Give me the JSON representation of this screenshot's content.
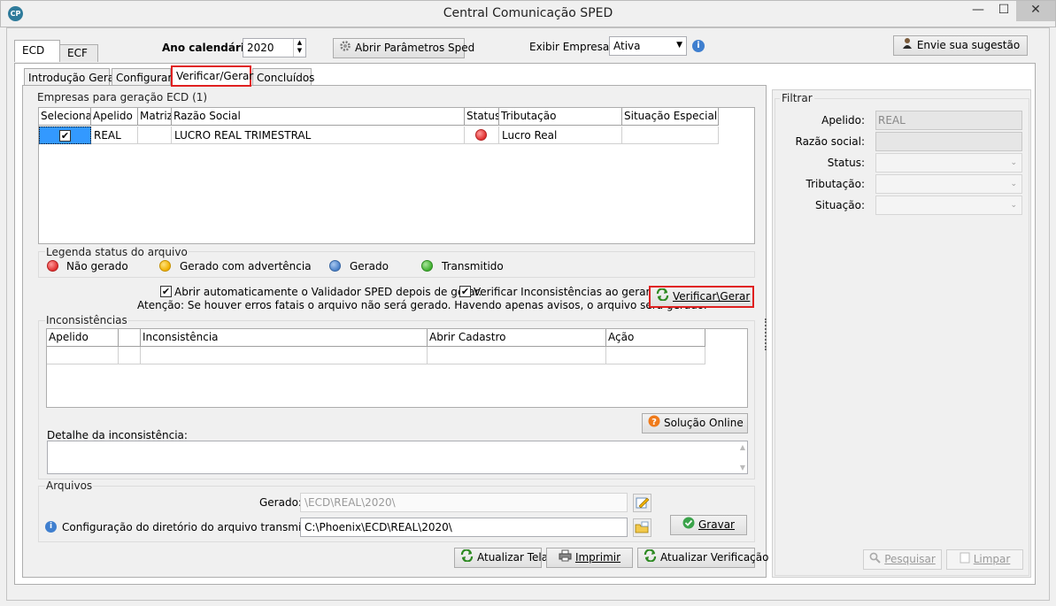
{
  "window": {
    "title": "Central Comunicação SPED",
    "icon_text": "CP",
    "minimize": "—",
    "maximize": "☐",
    "close": "✕"
  },
  "top_tabs": [
    "ECD",
    "ECF"
  ],
  "toolbar": {
    "ano_label": "Ano calendário:",
    "ano_value": "2020",
    "abrir_parametros": "Abrir Parâmetros Sped",
    "exibir_label": "Exibir Empresas:",
    "exibir_value": "Ativa",
    "sugestao": "Envie sua sugestão"
  },
  "sub_tabs": [
    "Introdução Geral",
    "Configurar",
    "Verificar/Gerar",
    "Concluídos"
  ],
  "empresas": {
    "title": "Empresas para geração ECD (1)",
    "columns": [
      "Selecionar",
      "Apelido",
      "Matriz",
      "Razão Social",
      "Status",
      "Tributação",
      "Situação Especial"
    ],
    "rows": [
      {
        "selecionar": "✔",
        "apelido": "REAL",
        "matriz": "",
        "razao_social": "LUCRO REAL TRIMESTRAL",
        "status": "red",
        "tributacao": "Lucro Real",
        "situacao": ""
      }
    ]
  },
  "legenda": {
    "title": "Legenda status do arquivo",
    "items": [
      {
        "label": "Não gerado",
        "color": "red"
      },
      {
        "label": "Gerado com advertência",
        "color": "yellow"
      },
      {
        "label": "Gerado",
        "color": "blue"
      },
      {
        "label": "Transmitido",
        "color": "green"
      }
    ]
  },
  "options": {
    "abrir_validador": "Abrir automaticamente o Validador SPED depois de gerar.",
    "verificar_inconsistencias": "Verificar Inconsistências ao gerar",
    "atencao": "Atenção: Se houver erros fatais o arquivo não será gerado. Havendo apenas avisos, o arquivo será gerado.",
    "verificar_gerar": "Verificar\\Gerar"
  },
  "inconsistencias": {
    "title": "Inconsistências",
    "columns": [
      "Apelido",
      "",
      "Inconsistência",
      "Abrir Cadastro",
      "Ação"
    ],
    "solucao_online": "Solução Online",
    "detalhe_label": "Detalhe da inconsistência:"
  },
  "arquivos": {
    "title": "Arquivos",
    "gerado_label": "Gerado:",
    "gerado_value": "\\ECD\\REAL\\2020\\",
    "config_label": "Configuração do diretório do arquivo transmitido:",
    "config_value": "C:\\Phoenix\\ECD\\REAL\\2020\\",
    "gravar": "Gravar"
  },
  "bottom_buttons": {
    "atualizar_tela": "Atualizar Tela",
    "imprimir": "Imprimir",
    "atualizar_verificacao": "Atualizar Verificação"
  },
  "filtrar": {
    "title": "Filtrar",
    "apelido_label": "Apelido:",
    "apelido_value": "REAL",
    "razao_label": "Razão social:",
    "status_label": "Status:",
    "tributacao_label": "Tributação:",
    "situacao_label": "Situação:",
    "pesquisar": "Pesquisar",
    "limpar": "Limpar"
  },
  "colors": {
    "highlight_red": "#e02020",
    "selection_blue": "#3399ff"
  }
}
